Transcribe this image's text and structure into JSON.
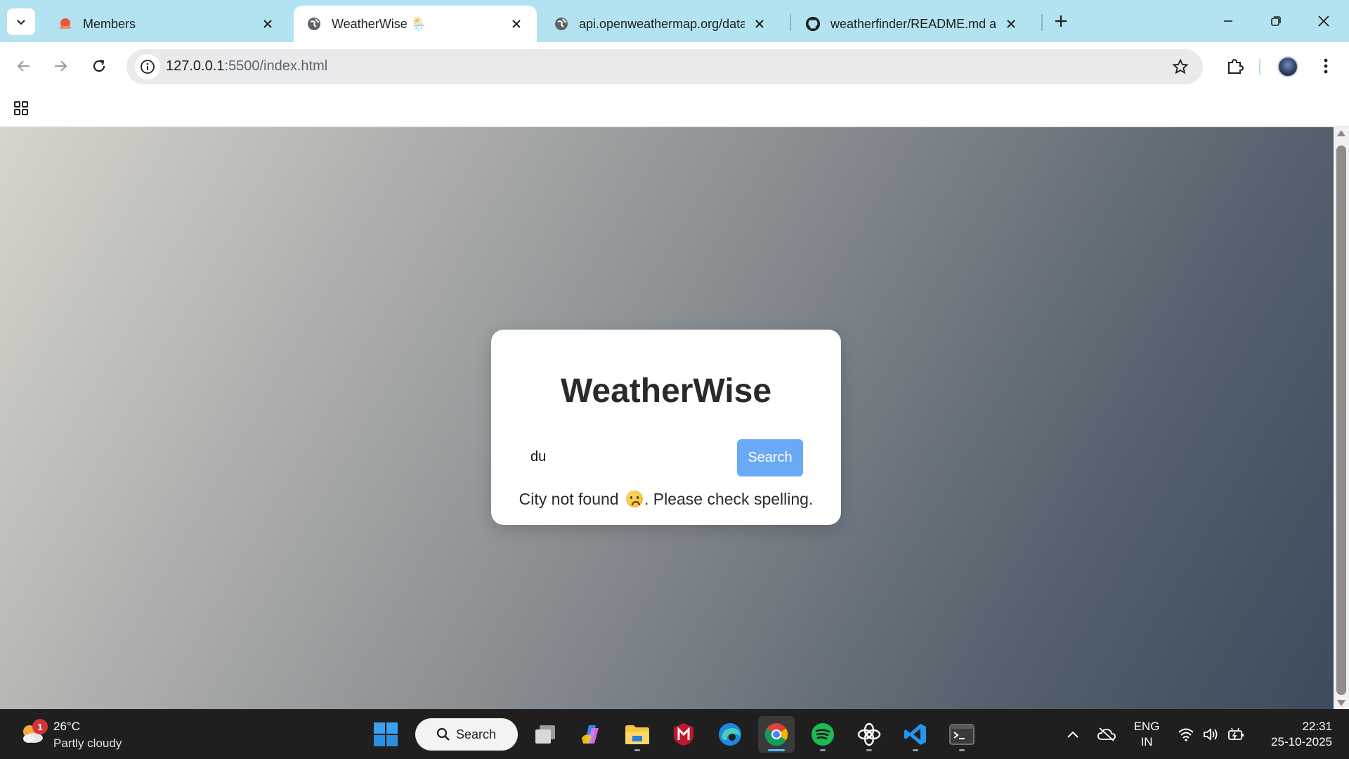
{
  "browser": {
    "tabs": [
      {
        "title": "Members",
        "favicon": "members-favicon",
        "active": false
      },
      {
        "title": "WeatherWise 🌦️",
        "favicon": "globe-icon",
        "active": true
      },
      {
        "title": "api.openweathermap.org/data/",
        "favicon": "globe-icon",
        "active": false
      },
      {
        "title": "weatherfinder/README.md at m",
        "favicon": "github-icon",
        "active": false
      }
    ],
    "address": {
      "host": "127.0.0.1",
      "path": ":5500/index.html"
    }
  },
  "page": {
    "title": "WeatherWise",
    "input_value": "du",
    "search_label": "Search",
    "error_before": "City not found",
    "error_after": ". Please check spelling.",
    "accent_color": "#6aa9f5"
  },
  "taskbar": {
    "weather": {
      "badge": "1",
      "temp": "26°C",
      "desc": "Partly cloudy"
    },
    "search_label": "Search",
    "apps": [
      "task-view",
      "copilot",
      "file-explorer",
      "mcafee",
      "edge",
      "chrome",
      "spotify",
      "chatgpt",
      "vscode",
      "terminal"
    ],
    "language": {
      "line1": "ENG",
      "line2": "IN"
    },
    "clock": {
      "time": "22:31",
      "date": "25-10-2025"
    }
  }
}
